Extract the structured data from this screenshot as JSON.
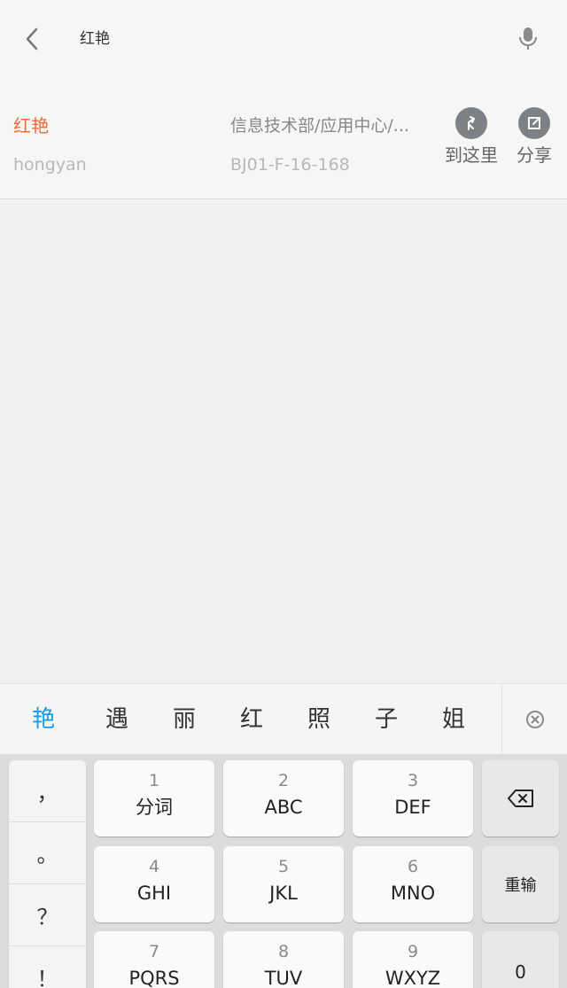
{
  "search": {
    "query": "红艳"
  },
  "result": {
    "name": "红艳",
    "pinyin": "hongyan",
    "department": "信息技术部/应用中心/...",
    "room": "BJ01-F-16-168",
    "actions": {
      "go_label": "到这里",
      "share_label": "分享"
    }
  },
  "candidates": [
    "艳",
    "遇",
    "丽",
    "红",
    "照",
    "子",
    "姐"
  ],
  "keyboard": {
    "punctuation": [
      "，",
      "。",
      "？",
      "！"
    ],
    "keys": [
      {
        "num": "1",
        "letters": "分词"
      },
      {
        "num": "2",
        "letters": "ABC"
      },
      {
        "num": "3",
        "letters": "DEF"
      },
      {
        "num": "4",
        "letters": "GHI"
      },
      {
        "num": "5",
        "letters": "JKL"
      },
      {
        "num": "6",
        "letters": "MNO"
      },
      {
        "num": "7",
        "letters": "PQRS"
      },
      {
        "num": "8",
        "letters": "TUV"
      },
      {
        "num": "9",
        "letters": "WXYZ"
      }
    ],
    "retype_label": "重输",
    "zero_label": "0"
  },
  "colors": {
    "accent": "#f06a3a",
    "selected_candidate": "#1a9be8",
    "action_icon_bg": "#7d8084"
  }
}
